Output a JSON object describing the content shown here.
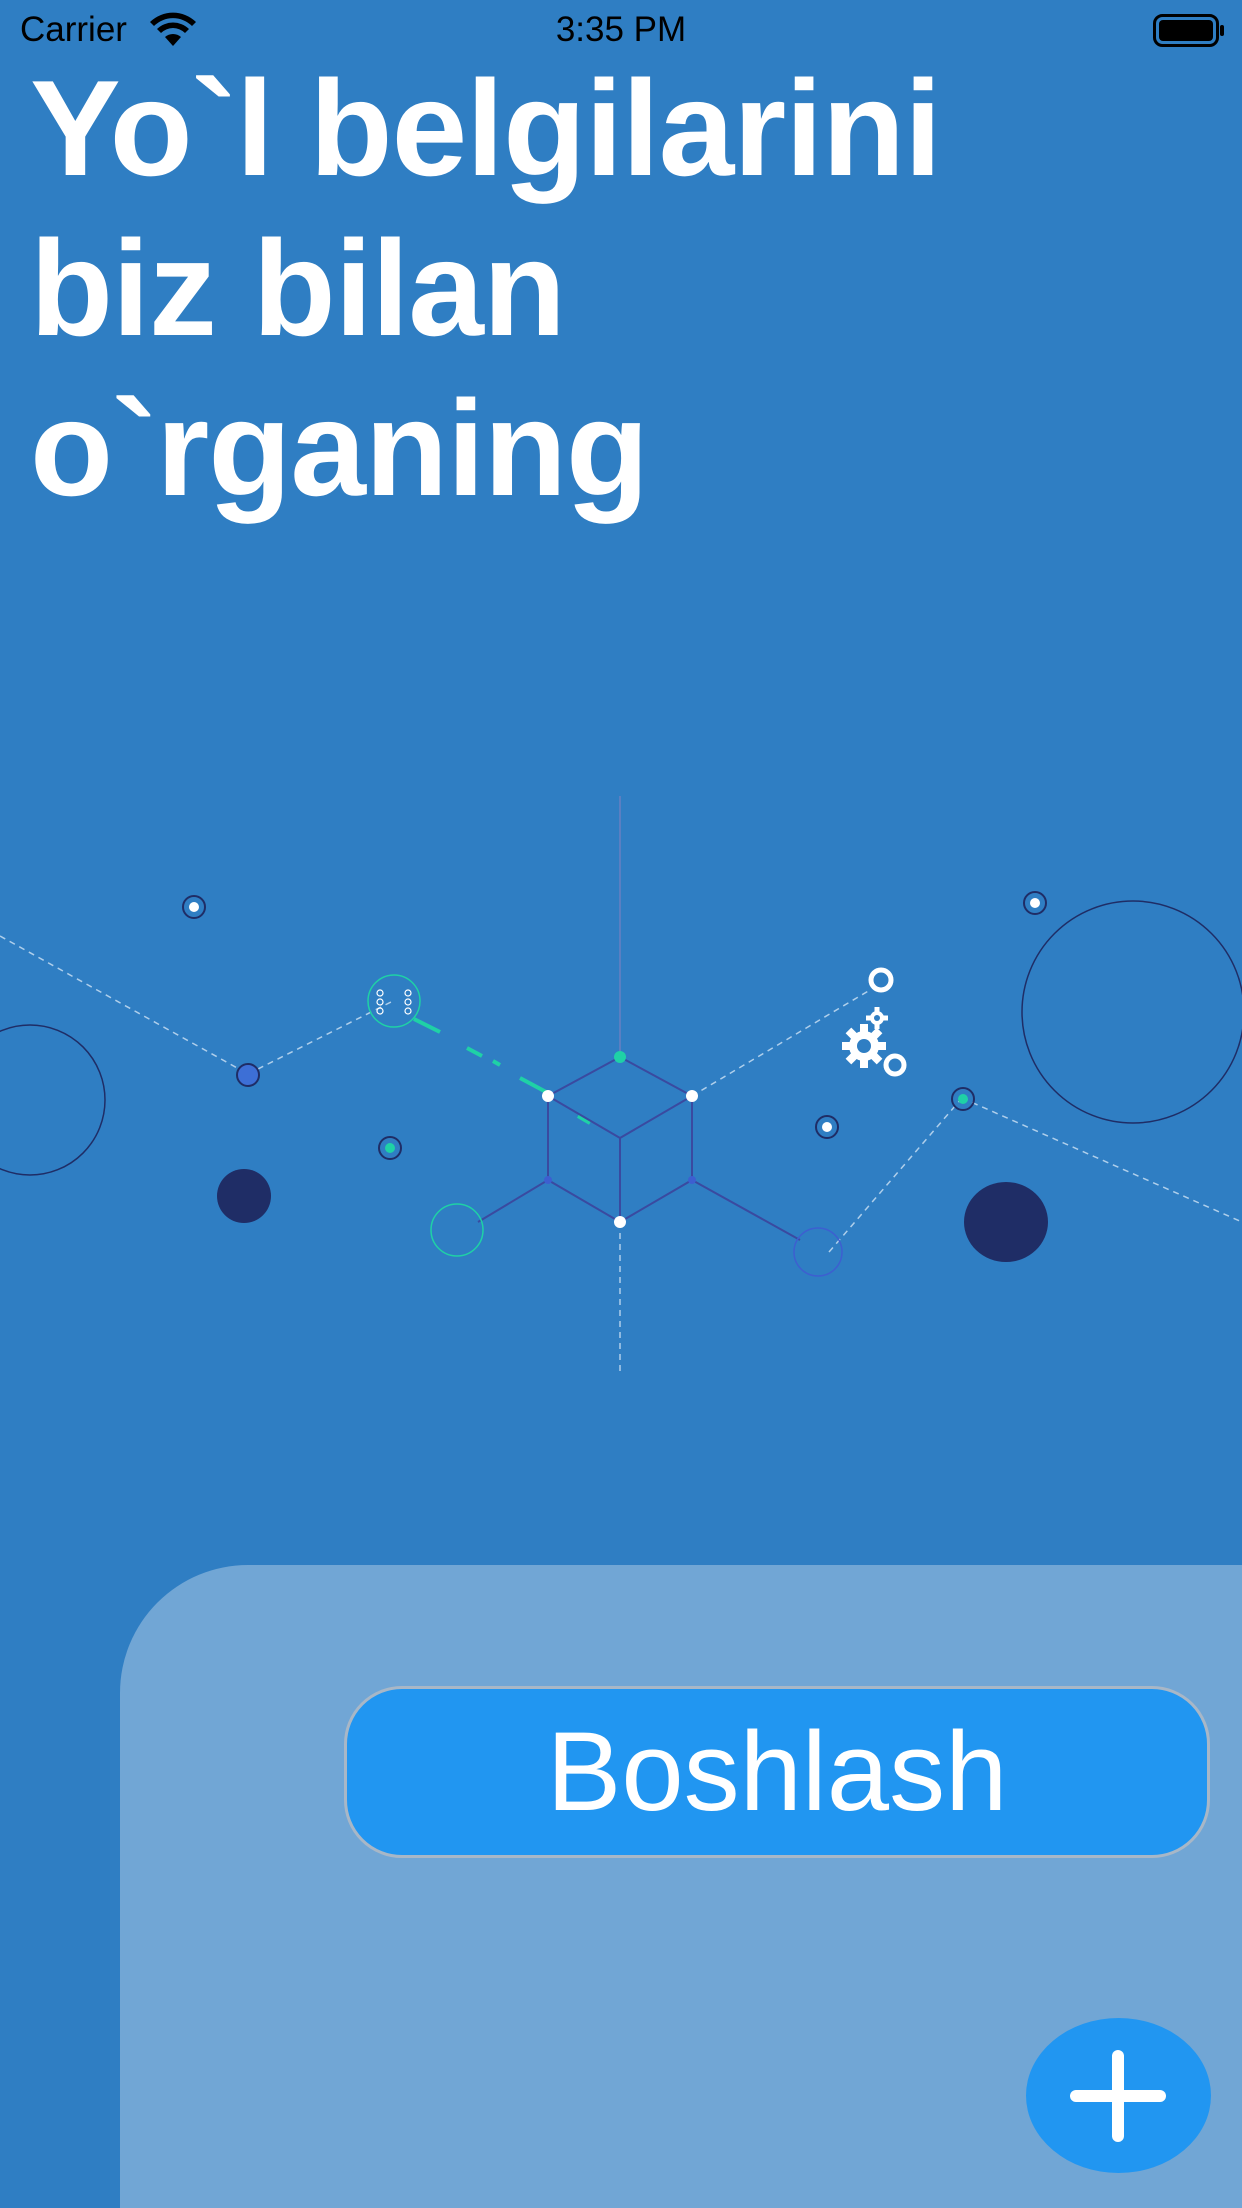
{
  "status_bar": {
    "carrier": "Carrier",
    "time": "3:35 PM"
  },
  "hero": {
    "title_line_1": "Yo`l belgilarini",
    "title_line_2": "biz bilan",
    "title_line_3": "o`rganing"
  },
  "actions": {
    "start_label": "Boshlash",
    "add_icon": "plus-icon"
  },
  "colors": {
    "background": "#2f7ec3",
    "panel": "#71a6d5",
    "button": "#2196f1",
    "accent_teal": "#1fd1a6",
    "dark_navy": "#1f2d66"
  },
  "icons": {
    "wifi": "wifi-icon",
    "battery": "battery-icon",
    "gears": "gears-icon"
  }
}
